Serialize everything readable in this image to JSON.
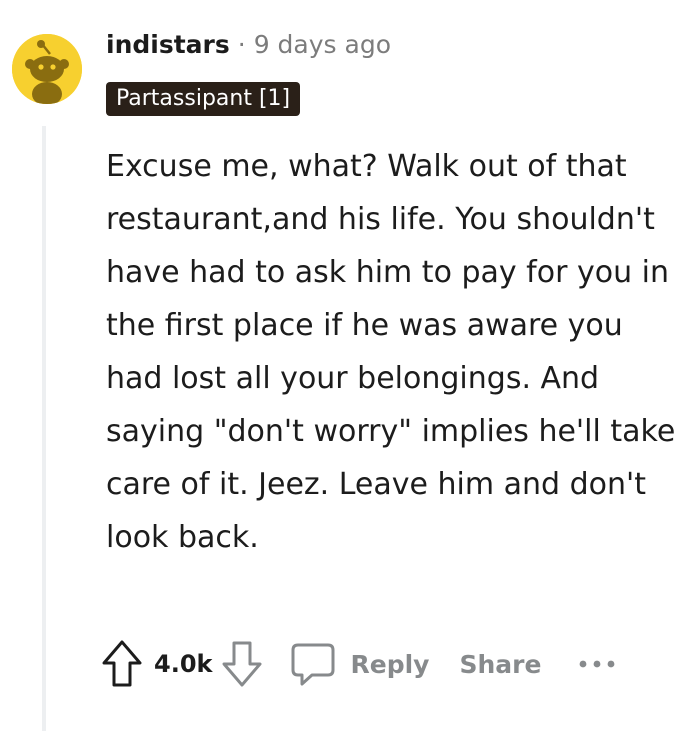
{
  "comment": {
    "username": "indistars",
    "separator": "·",
    "timestamp": "9 days ago",
    "flair": "Partassipant [1]",
    "paragraph": "Excuse me, what? Walk out of that restaurant,and his life. You shouldn't have had to ask him to pay for you in the first place if he was aware you had lost all your belongings. And saying \"don't worry\" implies he'll take care of it. Jeez. Leave him and don't look back."
  },
  "actions": {
    "score": "4.0k",
    "reply_label": "Reply",
    "share_label": "Share"
  },
  "icons": {
    "avatar": "snoo-avatar-icon",
    "upvote": "upvote-arrow-icon",
    "downvote": "downvote-arrow-icon",
    "reply": "speech-bubble-icon",
    "more": "more-options-icon"
  },
  "colors": {
    "avatar_bg": "#f7d02f",
    "flair_bg": "#2a2018",
    "muted_text": "#7c7c7c",
    "action_text": "#878a8c"
  }
}
